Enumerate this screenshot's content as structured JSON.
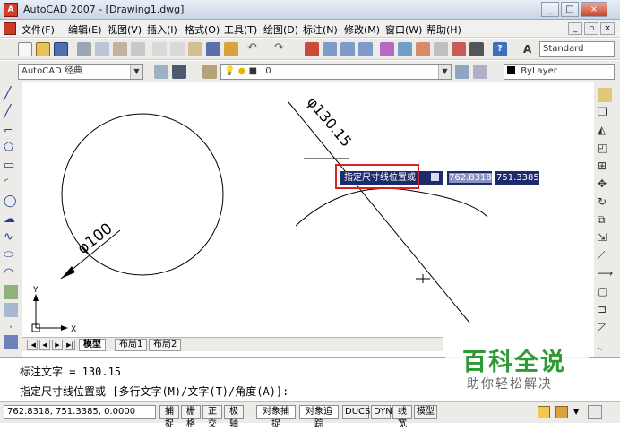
{
  "title_bar": {
    "app_title": "AutoCAD 2007 - [Drawing1.dwg]",
    "minimize": "_",
    "maximize": "□",
    "close": "×"
  },
  "menu": {
    "items": [
      "文件(F)",
      "编辑(E)",
      "视图(V)",
      "插入(I)",
      "格式(O)",
      "工具(T)",
      "绘图(D)",
      "标注(N)",
      "修改(M)",
      "窗口(W)",
      "帮助(H)"
    ],
    "doc_min": "_",
    "doc_max": "▫",
    "doc_close": "×"
  },
  "toolbar": {
    "text_style": "Standard",
    "workspace": "AutoCAD 经典",
    "layer": "0",
    "color": "ByLayer"
  },
  "drawing": {
    "circle_dim": "φ100",
    "dim_label": "φ130.15",
    "ucs_x": "X",
    "ucs_y": "Y"
  },
  "dynamic_input": {
    "prompt": "指定尺寸线位置或",
    "value1": "762.8318",
    "value2": "751.3385"
  },
  "tabs": {
    "model": "模型",
    "layout1": "布局1",
    "layout2": "布局2"
  },
  "command": {
    "history": "标注文字 = 130.15",
    "prompt": "指定尺寸线位置或 [多行文字(M)/文字(T)/角度(A)]:"
  },
  "status_bar": {
    "coordinates": "762.8318,  751.3385,  0.0000",
    "buttons": [
      "捕捉",
      "栅格",
      "正交",
      "极轴",
      "对象捕捉",
      "对象追踪",
      "DUCS",
      "DYN",
      "线宽",
      "模型"
    ]
  },
  "watermark": {
    "line1": "百科全说",
    "line2": "助你轻松解决"
  },
  "colors": {
    "accent_red": "#d62323",
    "tooltip_bg": "#1f2a6c",
    "watermark_green": "#2d9b33"
  }
}
